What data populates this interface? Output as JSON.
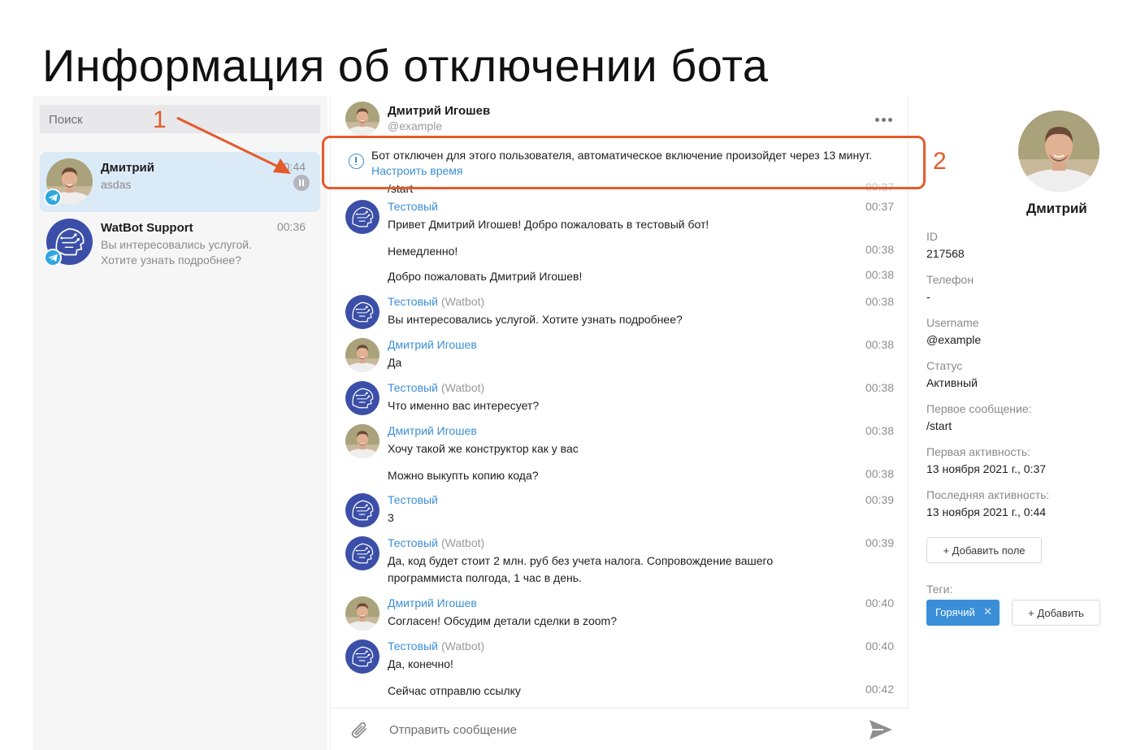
{
  "slide_title": "Информация об отключении бота",
  "sidebar": {
    "search_placeholder": "Поиск",
    "chats": [
      {
        "name": "Дмитрий",
        "preview": "asdas",
        "time": "0:44",
        "paused": true
      },
      {
        "name": "WatBot Support",
        "preview": "Вы интересовались услугой. Хотите узнать подробнее?",
        "time": "00:36"
      }
    ]
  },
  "chat": {
    "header": {
      "name": "Дмитрий Игошев",
      "handle": "@example"
    },
    "alert": {
      "text": "Бот отключен для этого пользователя, автоматическое включение произойдет через 13 минут.",
      "link": "Настроить время"
    },
    "partial": {
      "text": "/start",
      "time": "00:37"
    },
    "messages": [
      {
        "sender": "Тестовый",
        "tag": "",
        "text": "Привет Дмитрий Игошев! Добро пожаловать в тестовый бот!",
        "time": "00:37",
        "avatar": "bot"
      },
      {
        "sender": "",
        "tag": "",
        "text": "Немедленно!",
        "time": "00:38",
        "avatar": ""
      },
      {
        "sender": "",
        "tag": "",
        "text": "Добро пожаловать Дмитрий Игошев!",
        "time": "00:38",
        "avatar": ""
      },
      {
        "sender": "Тестовый",
        "tag": "(Watbot)",
        "text": "Вы интересовались услугой. Хотите узнать подробнее?",
        "time": "00:38",
        "avatar": "bot"
      },
      {
        "sender": "Дмитрий Игошев",
        "tag": "",
        "text": "Да",
        "time": "00:38",
        "avatar": "user"
      },
      {
        "sender": "Тестовый",
        "tag": "(Watbot)",
        "text": "Что именно вас интересует?",
        "time": "00:38",
        "avatar": "bot"
      },
      {
        "sender": "Дмитрий Игошев",
        "tag": "",
        "text": "Хочу такой же конструктор как у вас",
        "time": "00:38",
        "avatar": "user"
      },
      {
        "sender": "",
        "tag": "",
        "text": "Можно выкупть копию кода?",
        "time": "00:38",
        "avatar": ""
      },
      {
        "sender": "Тестовый",
        "tag": "",
        "text": "3",
        "time": "00:39",
        "avatar": "bot"
      },
      {
        "sender": "Тестовый",
        "tag": "(Watbot)",
        "text": "Да, код будет стоит 2 млн. руб без учета налога. Сопровождение вашего программиста полгода, 1 час в день.",
        "time": "00:39",
        "avatar": "bot"
      },
      {
        "sender": "Дмитрий Игошев",
        "tag": "",
        "text": "Согласен! Обсудим детали сделки в zoom?",
        "time": "00:40",
        "avatar": "user"
      },
      {
        "sender": "Тестовый",
        "tag": "(Watbot)",
        "text": "Да, конечно!",
        "time": "00:40",
        "avatar": "bot"
      },
      {
        "sender": "",
        "tag": "",
        "text": "Сейчас отправлю ссылку",
        "time": "00:42",
        "avatar": ""
      }
    ],
    "composer_placeholder": "Отправить сообщение"
  },
  "profile": {
    "name": "Дмитрий",
    "fields": [
      {
        "label": "ID",
        "value": "217568"
      },
      {
        "label": "Телефон",
        "value": "-"
      },
      {
        "label": "Username",
        "value": "@example"
      },
      {
        "label": "Статус",
        "value": "Активный"
      },
      {
        "label": "Первое сообщение:",
        "value": "/start"
      },
      {
        "label": "Первая активность:",
        "value": "13 ноября 2021 г., 0:37"
      },
      {
        "label": "Последняя активность:",
        "value": "13 ноября 2021 г., 0:44"
      }
    ],
    "add_field_label": "+ Добавить поле",
    "tags_label": "Теги:",
    "tags": [
      "Горячий"
    ],
    "add_tag_label": "+ Добавить"
  },
  "annotations": {
    "one": "1",
    "two": "2"
  },
  "colors": {
    "accent": "#3a8fd8",
    "callout": "#e45b2c",
    "telegram": "#2ea6df",
    "active_chat": "#dbeaf7"
  }
}
